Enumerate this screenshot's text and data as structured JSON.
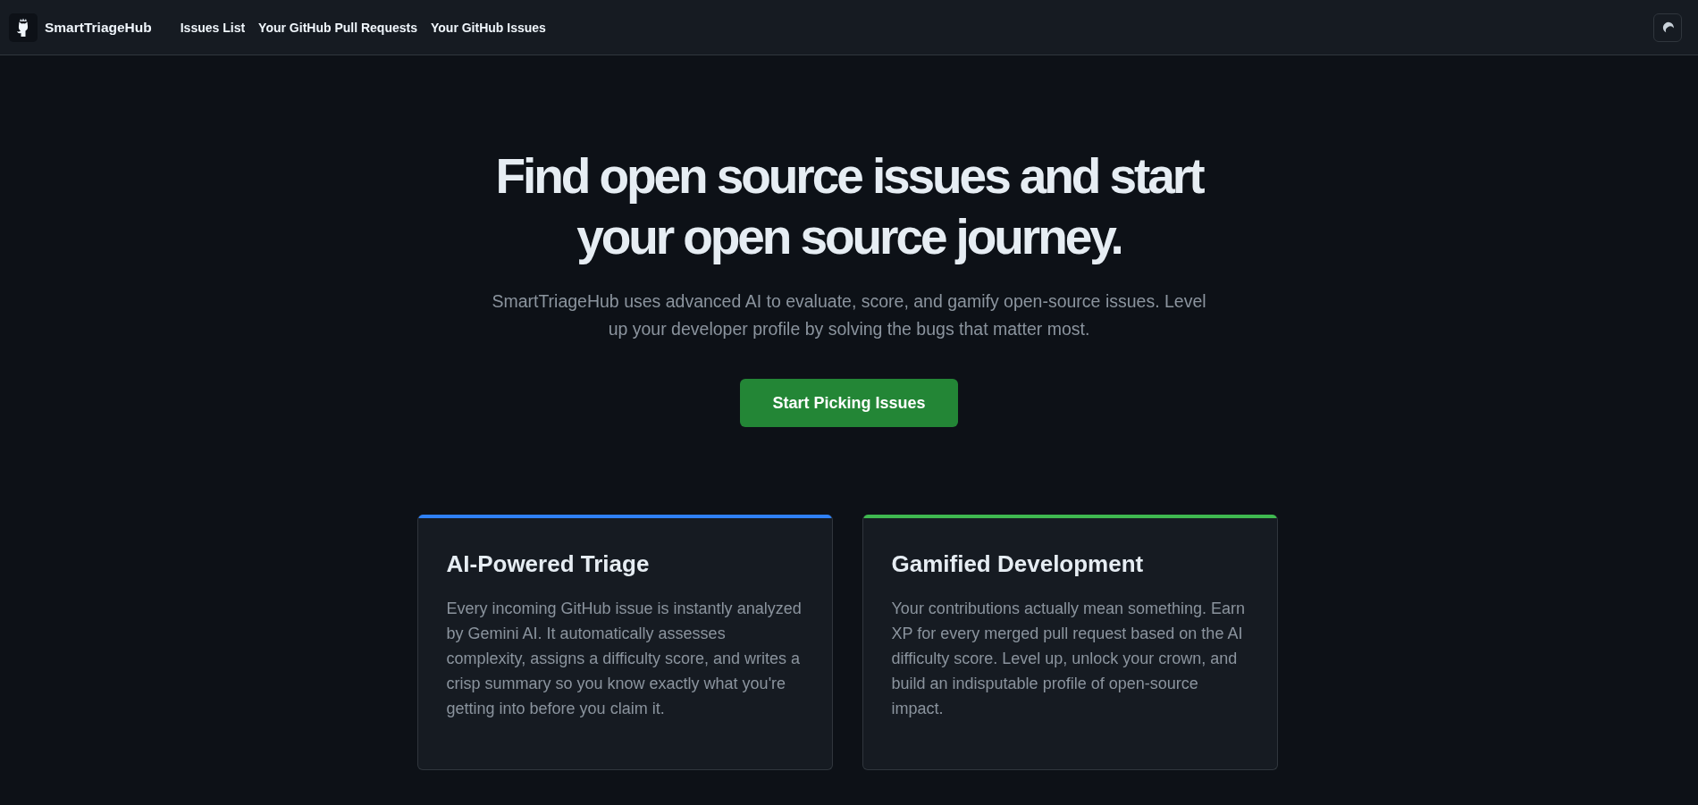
{
  "navbar": {
    "brand": "SmartTriageHub",
    "links": [
      {
        "label": "Issues List"
      },
      {
        "label": "Your GitHub Pull Requests"
      },
      {
        "label": "Your GitHub Issues"
      }
    ]
  },
  "hero": {
    "title": "Find open source issues and start your open source journey.",
    "subtitle": "SmartTriageHub uses advanced AI to evaluate, score, and gamify open-source issues. Level up your developer profile by solving the bugs that matter most.",
    "button": "Start Picking Issues"
  },
  "features": [
    {
      "title": "AI-Powered Triage",
      "text": "Every incoming GitHub issue is instantly analyzed by Gemini AI. It automatically assesses complexity, assigns a difficulty score, and writes a crisp summary so you know exactly what you're getting into before you claim it.",
      "color": "#2f81f7"
    },
    {
      "title": "Gamified Development",
      "text": "Your contributions actually mean something. Earn XP for every merged pull request based on the AI difficulty score. Level up, unlock your crown, and build an indisputable profile of open-source impact.",
      "color": "#3fb950"
    }
  ]
}
